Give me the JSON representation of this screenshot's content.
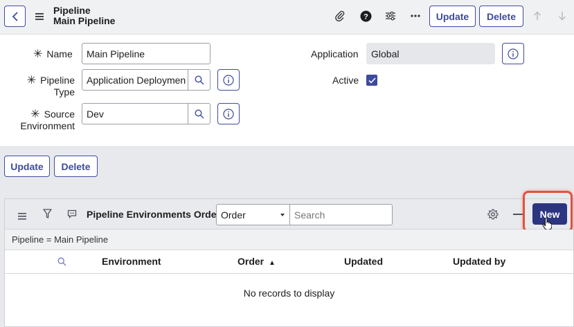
{
  "header": {
    "title_line1": "Pipeline",
    "title_line2": "Main Pipeline",
    "update_label": "Update",
    "delete_label": "Delete"
  },
  "form": {
    "name_label": "Name",
    "name_value": "Main Pipeline",
    "pipeline_type_label_1": "Pipeline",
    "pipeline_type_label_2": "Type",
    "pipeline_type_value": "Application Deploymen",
    "source_env_label_1": "Source",
    "source_env_label_2": "Environment",
    "source_env_value": "Dev",
    "application_label": "Application",
    "application_value": "Global",
    "active_label": "Active",
    "active_checked": true,
    "required_marker": "✳"
  },
  "actions": {
    "update_label": "Update",
    "delete_label": "Delete"
  },
  "related_list": {
    "title": "Pipeline Environments Order",
    "select_value": "Order",
    "search_placeholder": "Search",
    "new_label": "New",
    "filter_text": "Pipeline = Main Pipeline",
    "columns": [
      "Environment",
      "Order",
      "Updated",
      "Updated by"
    ],
    "sort_indicator": "▲",
    "empty_text": "No records to display"
  },
  "colors": {
    "accent": "#3e4a9c",
    "primary_button": "#2c3580",
    "highlight": "#e0533c"
  }
}
